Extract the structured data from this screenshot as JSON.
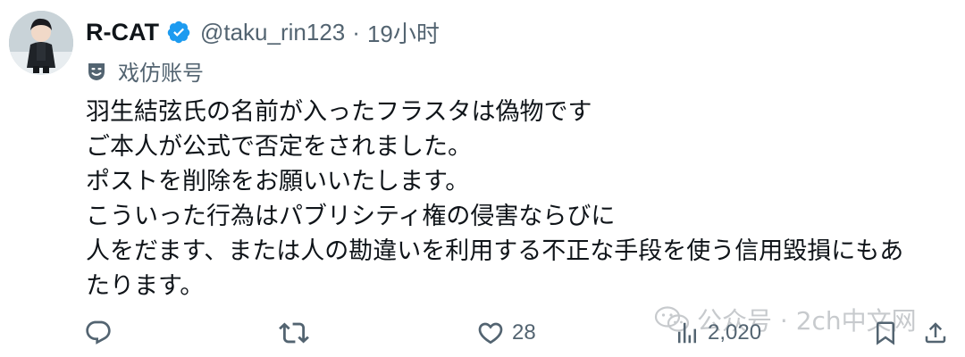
{
  "tweet": {
    "display_name": "R-CAT",
    "handle": "@taku_rin123",
    "separator": "·",
    "time": "19小时",
    "label": "戏仿账号",
    "body_lines": [
      "羽生結弦氏の名前が入ったフラスタは偽物です",
      "ご本人が公式で否定をされました。",
      "ポストを削除をお願いいたします。",
      "こういった行為はパブリシティ権の侵害ならびに",
      "人をだます、または人の勘違いを利用する不正な手段を使う信用毀損にもあ",
      "たります。"
    ]
  },
  "actions": {
    "reply_icon": "reply-icon",
    "retweet_icon": "retweet-icon",
    "like_icon": "heart-icon",
    "like_count": "28",
    "views_icon": "views-icon",
    "views_count": "2,020",
    "bookmark_icon": "bookmark-icon",
    "share_icon": "share-icon"
  },
  "watermark": {
    "text": "公众号 · 2ch中文网"
  },
  "colors": {
    "verified": "#1d9bf0",
    "secondary_text": "#536471",
    "primary_text": "#0f1419"
  }
}
